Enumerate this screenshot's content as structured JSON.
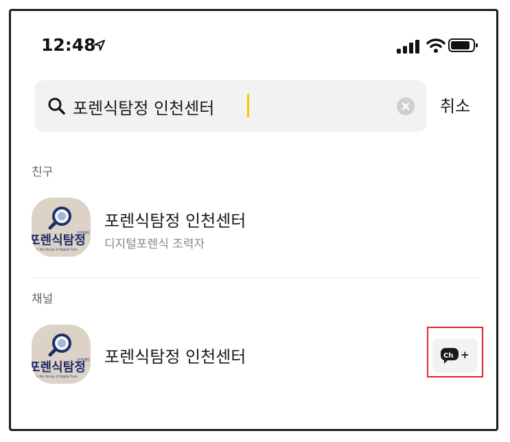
{
  "status_bar": {
    "time": "12:48"
  },
  "search": {
    "query": "포렌식탐정 인천센터",
    "cancel_label": "취소"
  },
  "sections": {
    "friends_label": "친구",
    "channels_label": "채널"
  },
  "friend_result": {
    "name": "포렌식탐정 인천센터",
    "subtitle": "디지털포렌식 조력자"
  },
  "channel_result": {
    "name": "포렌식탐정 인천센터",
    "add_button_badge": "Ch",
    "add_button_plus": "+"
  },
  "avatar_logo": {
    "text": "포렌식탐정",
    "small_text": "인천센터",
    "tagline": "for the Study of Digital Fore"
  },
  "colors": {
    "caret": "#f7c400",
    "highlight_border": "#e0242b",
    "logo_navy": "#1f2d6b"
  },
  "icons": {
    "location": "location-arrow-icon",
    "signal": "cellular-signal-icon",
    "wifi": "wifi-icon",
    "battery": "battery-icon",
    "search": "search-icon",
    "clear": "clear-icon",
    "channel_add": "channel-add-icon"
  }
}
